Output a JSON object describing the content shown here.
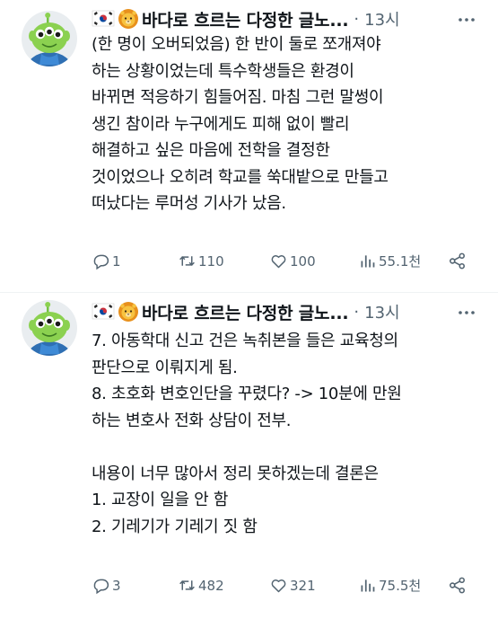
{
  "tweets": [
    {
      "author": "바다로 흐르는 다정한 글노...",
      "dot": "·",
      "time": "13시",
      "lines": [
        "(한 명이 오버되었음) 한 반이 둘로 쪼개져야",
        "하는 상황이었는데 특수학생들은 환경이",
        "바뀌면 적응하기 힘들어짐. 마침 그런 말썽이",
        "생긴 참이라 누구에게도 피해 없이 빨리",
        "해결하고 싶은 마음에 전학을 결정한",
        "것이었으나 오히려 학교를 쑥대밭으로 만들고",
        "떠났다는 루머성 기사가 났음."
      ],
      "replies": "1",
      "retweets": "110",
      "likes": "100",
      "views": "55.1천"
    },
    {
      "author": "바다로 흐르는 다정한 글노...",
      "dot": "·",
      "time": "13시",
      "lines": [
        "7. 아동학대 신고 건은 녹취본을 들은 교육청의",
        "판단으로 이뤄지게 됨.",
        "8. 초호화 변호인단을 꾸렸다? -> 10분에 만원",
        "하는 변호사 전화 상담이 전부.",
        "",
        "내용이 너무 많아서 정리 못하겠는데 결론은",
        "1. 교장이 일을 안 함",
        "2. 기레기가 기레기 짓 함"
      ],
      "replies": "3",
      "retweets": "482",
      "likes": "321",
      "views": "75.5천"
    }
  ],
  "colors": {
    "text": "#0f1419",
    "muted": "#536471",
    "divider": "#eff3f4"
  },
  "icons": [
    "avatar-alien",
    "korea-flag-icon",
    "lion-face-icon",
    "more-icon",
    "reply-icon",
    "retweet-icon",
    "like-icon",
    "views-icon",
    "share-icon"
  ]
}
